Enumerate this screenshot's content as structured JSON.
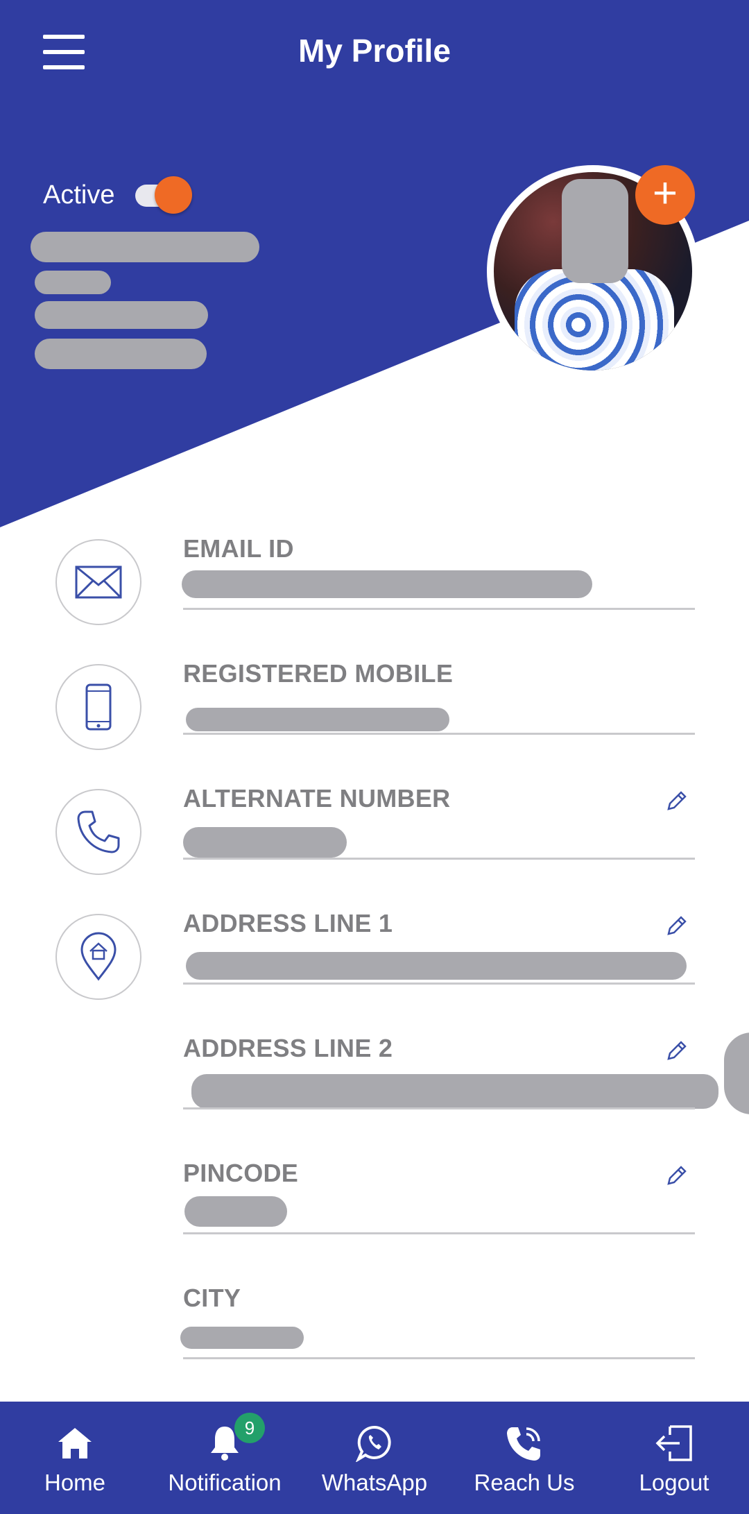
{
  "header": {
    "title": "My Profile"
  },
  "profile": {
    "status_label": "Active",
    "status_on": true
  },
  "fields": [
    {
      "label": "EMAIL ID",
      "value": "",
      "icon": "envelope-icon",
      "editable": false
    },
    {
      "label": "REGISTERED MOBILE",
      "value": "",
      "icon": "mobile-phone-icon",
      "editable": false
    },
    {
      "label": "ALTERNATE NUMBER",
      "value": "",
      "icon": "phone-handset-icon",
      "editable": true
    },
    {
      "label": "ADDRESS LINE 1",
      "value": "",
      "icon": "location-pin-home-icon",
      "editable": true
    },
    {
      "label": "ADDRESS LINE 2",
      "value": "",
      "icon": "",
      "editable": true
    },
    {
      "label": "PINCODE",
      "value": "",
      "icon": "",
      "editable": true
    },
    {
      "label": "CITY",
      "value": "",
      "icon": "",
      "editable": false
    }
  ],
  "bottom_nav": [
    {
      "label": "Home",
      "icon": "home-icon"
    },
    {
      "label": "Notification",
      "icon": "bell-icon",
      "badge": "9"
    },
    {
      "label": "WhatsApp",
      "icon": "whatsapp-icon"
    },
    {
      "label": "Reach Us",
      "icon": "phone-call-icon"
    },
    {
      "label": "Logout",
      "icon": "logout-icon"
    }
  ],
  "colors": {
    "primary": "#303da1",
    "accent": "#ef6a25",
    "badge": "#23a06a",
    "label_gray": "#7f7f82",
    "redaction_gray": "#a9a9ae",
    "icon_blue": "#3a4fa8"
  }
}
